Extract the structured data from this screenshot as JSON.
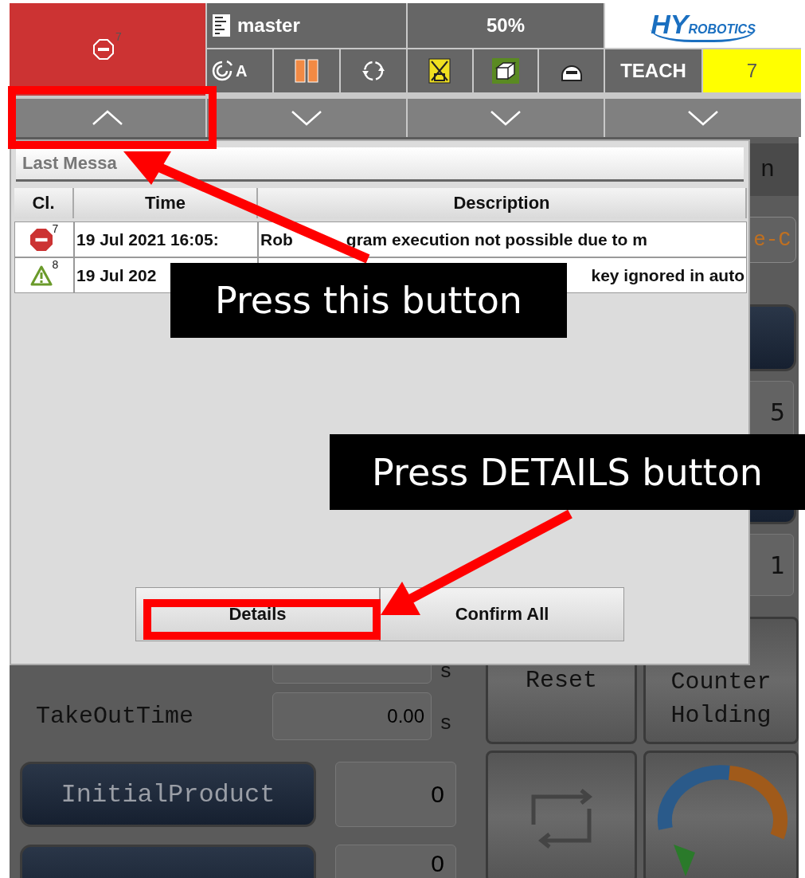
{
  "top_bar": {
    "alarm": {
      "kind": "error",
      "count": "7"
    },
    "program": {
      "name": "master",
      "mode_label": "A"
    },
    "override": {
      "value": "50%"
    },
    "logo": {
      "big": "HY",
      "small": "ROBOTICS"
    },
    "mode": {
      "name": "TEACH",
      "value": "7"
    },
    "toggles": [
      {
        "expanded": true
      },
      {
        "expanded": false
      },
      {
        "expanded": false
      },
      {
        "expanded": false
      }
    ]
  },
  "dialog": {
    "title": "Last Messa",
    "columns": [
      "Cl.",
      "Time",
      "Description"
    ],
    "rows": [
      {
        "kind": "error",
        "count": "7",
        "time": "19 Jul 2021 16:05:",
        "description": [
          "Rob",
          "gram execution not possible due to m"
        ]
      },
      {
        "kind": "warning",
        "count": "8",
        "time": "19 Jul 202",
        "description": [
          "key ignored in auto"
        ]
      }
    ],
    "buttons": [
      "Details",
      "Confirm All"
    ]
  },
  "background": {
    "tab_label": "n",
    "orange_button": "e-C",
    "fields": [
      "5",
      "1"
    ],
    "rows": [
      {
        "label": "",
        "value": "",
        "unit": "s"
      },
      {
        "label": "TakeOutTime",
        "value": "0.00",
        "unit": "s"
      }
    ],
    "counters": [
      {
        "button": "InitialProduct",
        "value": "0"
      },
      {
        "value": "0"
      }
    ],
    "reset": "Reset",
    "holding": [
      "Counter",
      "Holding"
    ]
  },
  "annotations": [
    {
      "text": "Press this button"
    },
    {
      "text": "Press DETAILS button"
    }
  ]
}
